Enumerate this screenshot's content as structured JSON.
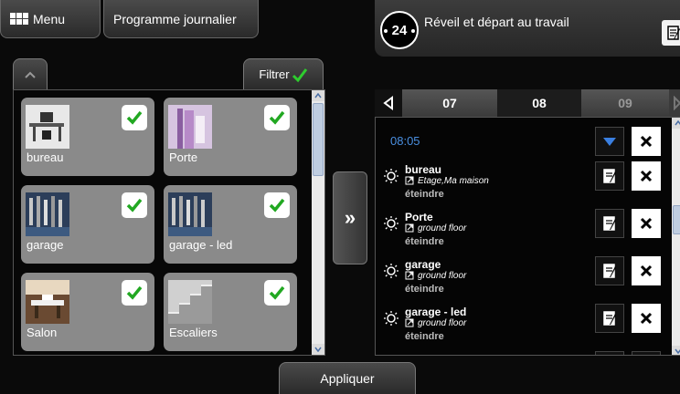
{
  "top_bar": {
    "menu_label": "Menu",
    "programme_label": "Programme journalier"
  },
  "header": {
    "clock_number": "24",
    "title": "Réveil et départ au travail"
  },
  "filter": {
    "label": "Filtrer"
  },
  "devices": [
    {
      "label": "bureau",
      "checked": true,
      "icon": "office-desk-photo"
    },
    {
      "label": "Porte",
      "checked": true,
      "icon": "door-photo"
    },
    {
      "label": "garage",
      "checked": true,
      "icon": "garage-tools-photo"
    },
    {
      "label": "garage - led",
      "checked": true,
      "icon": "garage-tools-photo"
    },
    {
      "label": "Salon",
      "checked": true,
      "icon": "living-room-photo"
    },
    {
      "label": "Escaliers",
      "checked": true,
      "icon": "stairs-photo"
    }
  ],
  "days": {
    "prev": "07",
    "current": "08",
    "next": "09"
  },
  "schedule": {
    "time": "08:05",
    "entries": [
      {
        "name": "bureau",
        "location": "Etage,Ma maison",
        "action": "éteindre"
      },
      {
        "name": "Porte",
        "location": "ground floor",
        "action": "éteindre"
      },
      {
        "name": "garage",
        "location": "ground floor",
        "action": "éteindre"
      },
      {
        "name": "garage - led",
        "location": "ground floor",
        "action": "éteindre"
      }
    ]
  },
  "apply_label": "Appliquer",
  "colors": {
    "accent_blue": "#4a8fe0",
    "check_green": "#22a822",
    "card_grey": "#8a8a8a"
  }
}
